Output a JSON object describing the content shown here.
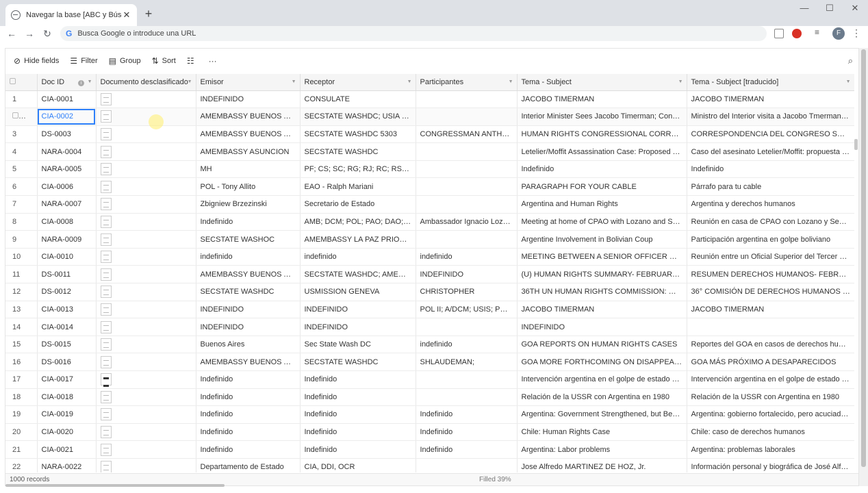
{
  "browser": {
    "tab_title": "Navegar la base [ABC y Búsqued",
    "omnibox_placeholder": "Busca Google o introduce una URL",
    "google_letter": "G",
    "avatar_letter": "F"
  },
  "viewbar": {
    "hide_fields": "Hide fields",
    "filter": "Filter",
    "group": "Group",
    "sort": "Sort"
  },
  "columns": [
    "Doc ID",
    "Documento desclasificado",
    "Emisor",
    "Receptor",
    "Participantes",
    "Tema - Subject",
    "Tema - Subject [traducido]"
  ],
  "rows": [
    {
      "n": "1",
      "id": "CIA-0001",
      "emisor": "INDEFINIDO",
      "receptor": "CONSULATE",
      "part": "",
      "tema": "JACOBO TIMERMAN",
      "trad": "JACOBO TIMERMAN"
    },
    {
      "n": "",
      "id": "CIA-0002",
      "emisor": "AMEMBASSY BUENOS AIRES",
      "receptor": "SECSTATE WASHDC; USIA WASH...",
      "part": "",
      "tema": "Interior Minister Sees Jacobo Timerman; Congress...",
      "trad": "Ministro del Interior visita a Jacobo Tmerman; tam..."
    },
    {
      "n": "3",
      "id": "DS-0003",
      "emisor": "AMEMBASSY BUENOS AIRES",
      "receptor": "SECSTATE WASHDC 5303",
      "part": "CONGRESSMAN ANTHON...",
      "tema": "HUMAN RIGHTS CONGRESSIONAL CORRESPOND...",
      "trad": "CORRESPONDENCIA DEL CONGRESO SOBRE DER..."
    },
    {
      "n": "4",
      "id": "NARA-0004",
      "emisor": "AMEMBASSY ASUNCION",
      "receptor": "SECSTATE WASHDC",
      "part": "",
      "tema": "Letelier/Moffit Assassination Case: Proposed Trav...",
      "trad": "Caso del asesinato Letelier/Moffit: propuesta de vi..."
    },
    {
      "n": "5",
      "id": "NARA-0005",
      "emisor": "MH",
      "receptor": "PF; CS; SC; RG; RJ; RC; RS; BB; JG;...",
      "part": "",
      "tema": "Indefinido",
      "trad": "Indefinido"
    },
    {
      "n": "6",
      "id": "CIA-0006",
      "emisor": "POL - Tony Allito",
      "receptor": "EAO - Ralph Mariani",
      "part": "",
      "tema": "PARAGRAPH FOR YOUR CABLE",
      "trad": "Párrafo para tu cable"
    },
    {
      "n": "7",
      "id": "NARA-0007",
      "emisor": "Zbigniew Brzezinski",
      "receptor": "Secretario de Estado",
      "part": "",
      "tema": "Argentina and Human Rights",
      "trad": "Argentina y derechos humanos"
    },
    {
      "n": "8",
      "id": "CIA-0008",
      "emisor": "Indefinido",
      "receptor": "AMB; DCM; POL; PAO; DAO; POL...",
      "part": "Ambassador Ignacio Lozan...",
      "tema": "Meeting at home of CPAO with Lozano and Seaton",
      "trad": "Reunión en casa de CPAO con Lozano y Seaton"
    },
    {
      "n": "9",
      "id": "NARA-0009",
      "emisor": "SECSTATE WASHOC",
      "receptor": "AMEMBASSY LA PAZ PRIORITY; ...",
      "part": "",
      "tema": "Argentine Involvement in Bolivian Coup",
      "trad": "Participación argentina en golpe boliviano"
    },
    {
      "n": "10",
      "id": "CIA-0010",
      "emisor": "indefinido",
      "receptor": "indefinido",
      "part": "indefinido",
      "tema": "MEETING BETWEEN A SENIOR OFFICER OF THE A...",
      "trad": "Reunión entre un Oficial Superior del Tercer Cuerp..."
    },
    {
      "n": "11",
      "id": "DS-0011",
      "emisor": "AMEMBASSY BUENOS AIRES",
      "receptor": "SECSTATE WASHDC; AMEMBASS...",
      "part": "INDEFINIDO",
      "tema": "(U) HUMAN RIGHTS SUMMARY- FEBRUARY 16-22...",
      "trad": "RESUMEN DERECHOS HUMANOS- FEBRERO 16-2..."
    },
    {
      "n": "12",
      "id": "DS-0012",
      "emisor": "SECSTATE WASHDC",
      "receptor": "USMISSION GENEVA",
      "part": "CHRISTOPHER",
      "tema": "36TH UN HUMAN RIGHTS COMMISSION: WEO D...",
      "trad": "36° COMISIÓN DE DERECHOS HUMANOS DE LAS ..."
    },
    {
      "n": "13",
      "id": "CIA-0013",
      "emisor": "INDEFINIDO",
      "receptor": "INDEFINIDO",
      "part": "POL II; A/DCM; USIS; POL I",
      "tema": "JACOBO TIMERMAN",
      "trad": "JACOBO TIMERMAN"
    },
    {
      "n": "14",
      "id": "CIA-0014",
      "emisor": "INDEFINIDO",
      "receptor": "INDEFINIDO",
      "part": "",
      "tema": "INDEFINIDO",
      "trad": ""
    },
    {
      "n": "15",
      "id": "DS-0015",
      "emisor": "Buenos Aires",
      "receptor": "Sec State Wash DC",
      "part": "indefinido",
      "tema": "GOA REPORTS ON HUMAN RIGHTS CASES",
      "trad": "Reportes del GOA en casos de derechos humanos"
    },
    {
      "n": "16",
      "id": "DS-0016",
      "emisor": "AMEMBASSY BUENOS AIRES",
      "receptor": "SECSTATE WASHDC",
      "part": "SHLAUDEMAN;",
      "tema": "GOA MORE FORTHCOMING ON DISAPPEARED",
      "trad": "GOA MÁS PRÓXIMO A DESAPARECIDOS"
    },
    {
      "n": "17",
      "id": "CIA-0017",
      "emisor": "Indefinido",
      "receptor": "Indefinido",
      "part": "",
      "tema": "Intervención argentina en el golpe de estado a Bo...",
      "trad": "Intervención argentina en el golpe de estado a Bol..."
    },
    {
      "n": "18",
      "id": "CIA-0018",
      "emisor": "Indefinido",
      "receptor": "Indefinido",
      "part": "",
      "tema": "Relación de la USSR con Argentina en 1980",
      "trad": "Relación de la USSR con Argentina en 1980"
    },
    {
      "n": "19",
      "id": "CIA-0019",
      "emisor": "Indefinido",
      "receptor": "Indefinido",
      "part": "Indefinido",
      "tema": "Argentina: Government Strengthened, but Beset ...",
      "trad": "Argentina: gobierno fortalecido, pero acuciado po..."
    },
    {
      "n": "20",
      "id": "CIA-0020",
      "emisor": "Indefinido",
      "receptor": "Indefinido",
      "part": "Indefinido",
      "tema": "Chile: Human Rights Case",
      "trad": "Chile: caso de derechos humanos"
    },
    {
      "n": "21",
      "id": "CIA-0021",
      "emisor": "Indefinido",
      "receptor": "Indefinido",
      "part": "Indefinido",
      "tema": "Argentina: Labor problems",
      "trad": "Argentina: problemas laborales"
    },
    {
      "n": "22",
      "id": "NARA-0022",
      "emisor": "Departamento de Estado",
      "receptor": "CIA, DDI, OCR",
      "part": "",
      "tema": "Jose Alfredo MARTINEZ DE HOZ, Jr.",
      "trad": "Información personal y biográfica de José Alfredo ..."
    }
  ],
  "footer": {
    "records": "1000 records",
    "filled": "Filled 39%"
  }
}
